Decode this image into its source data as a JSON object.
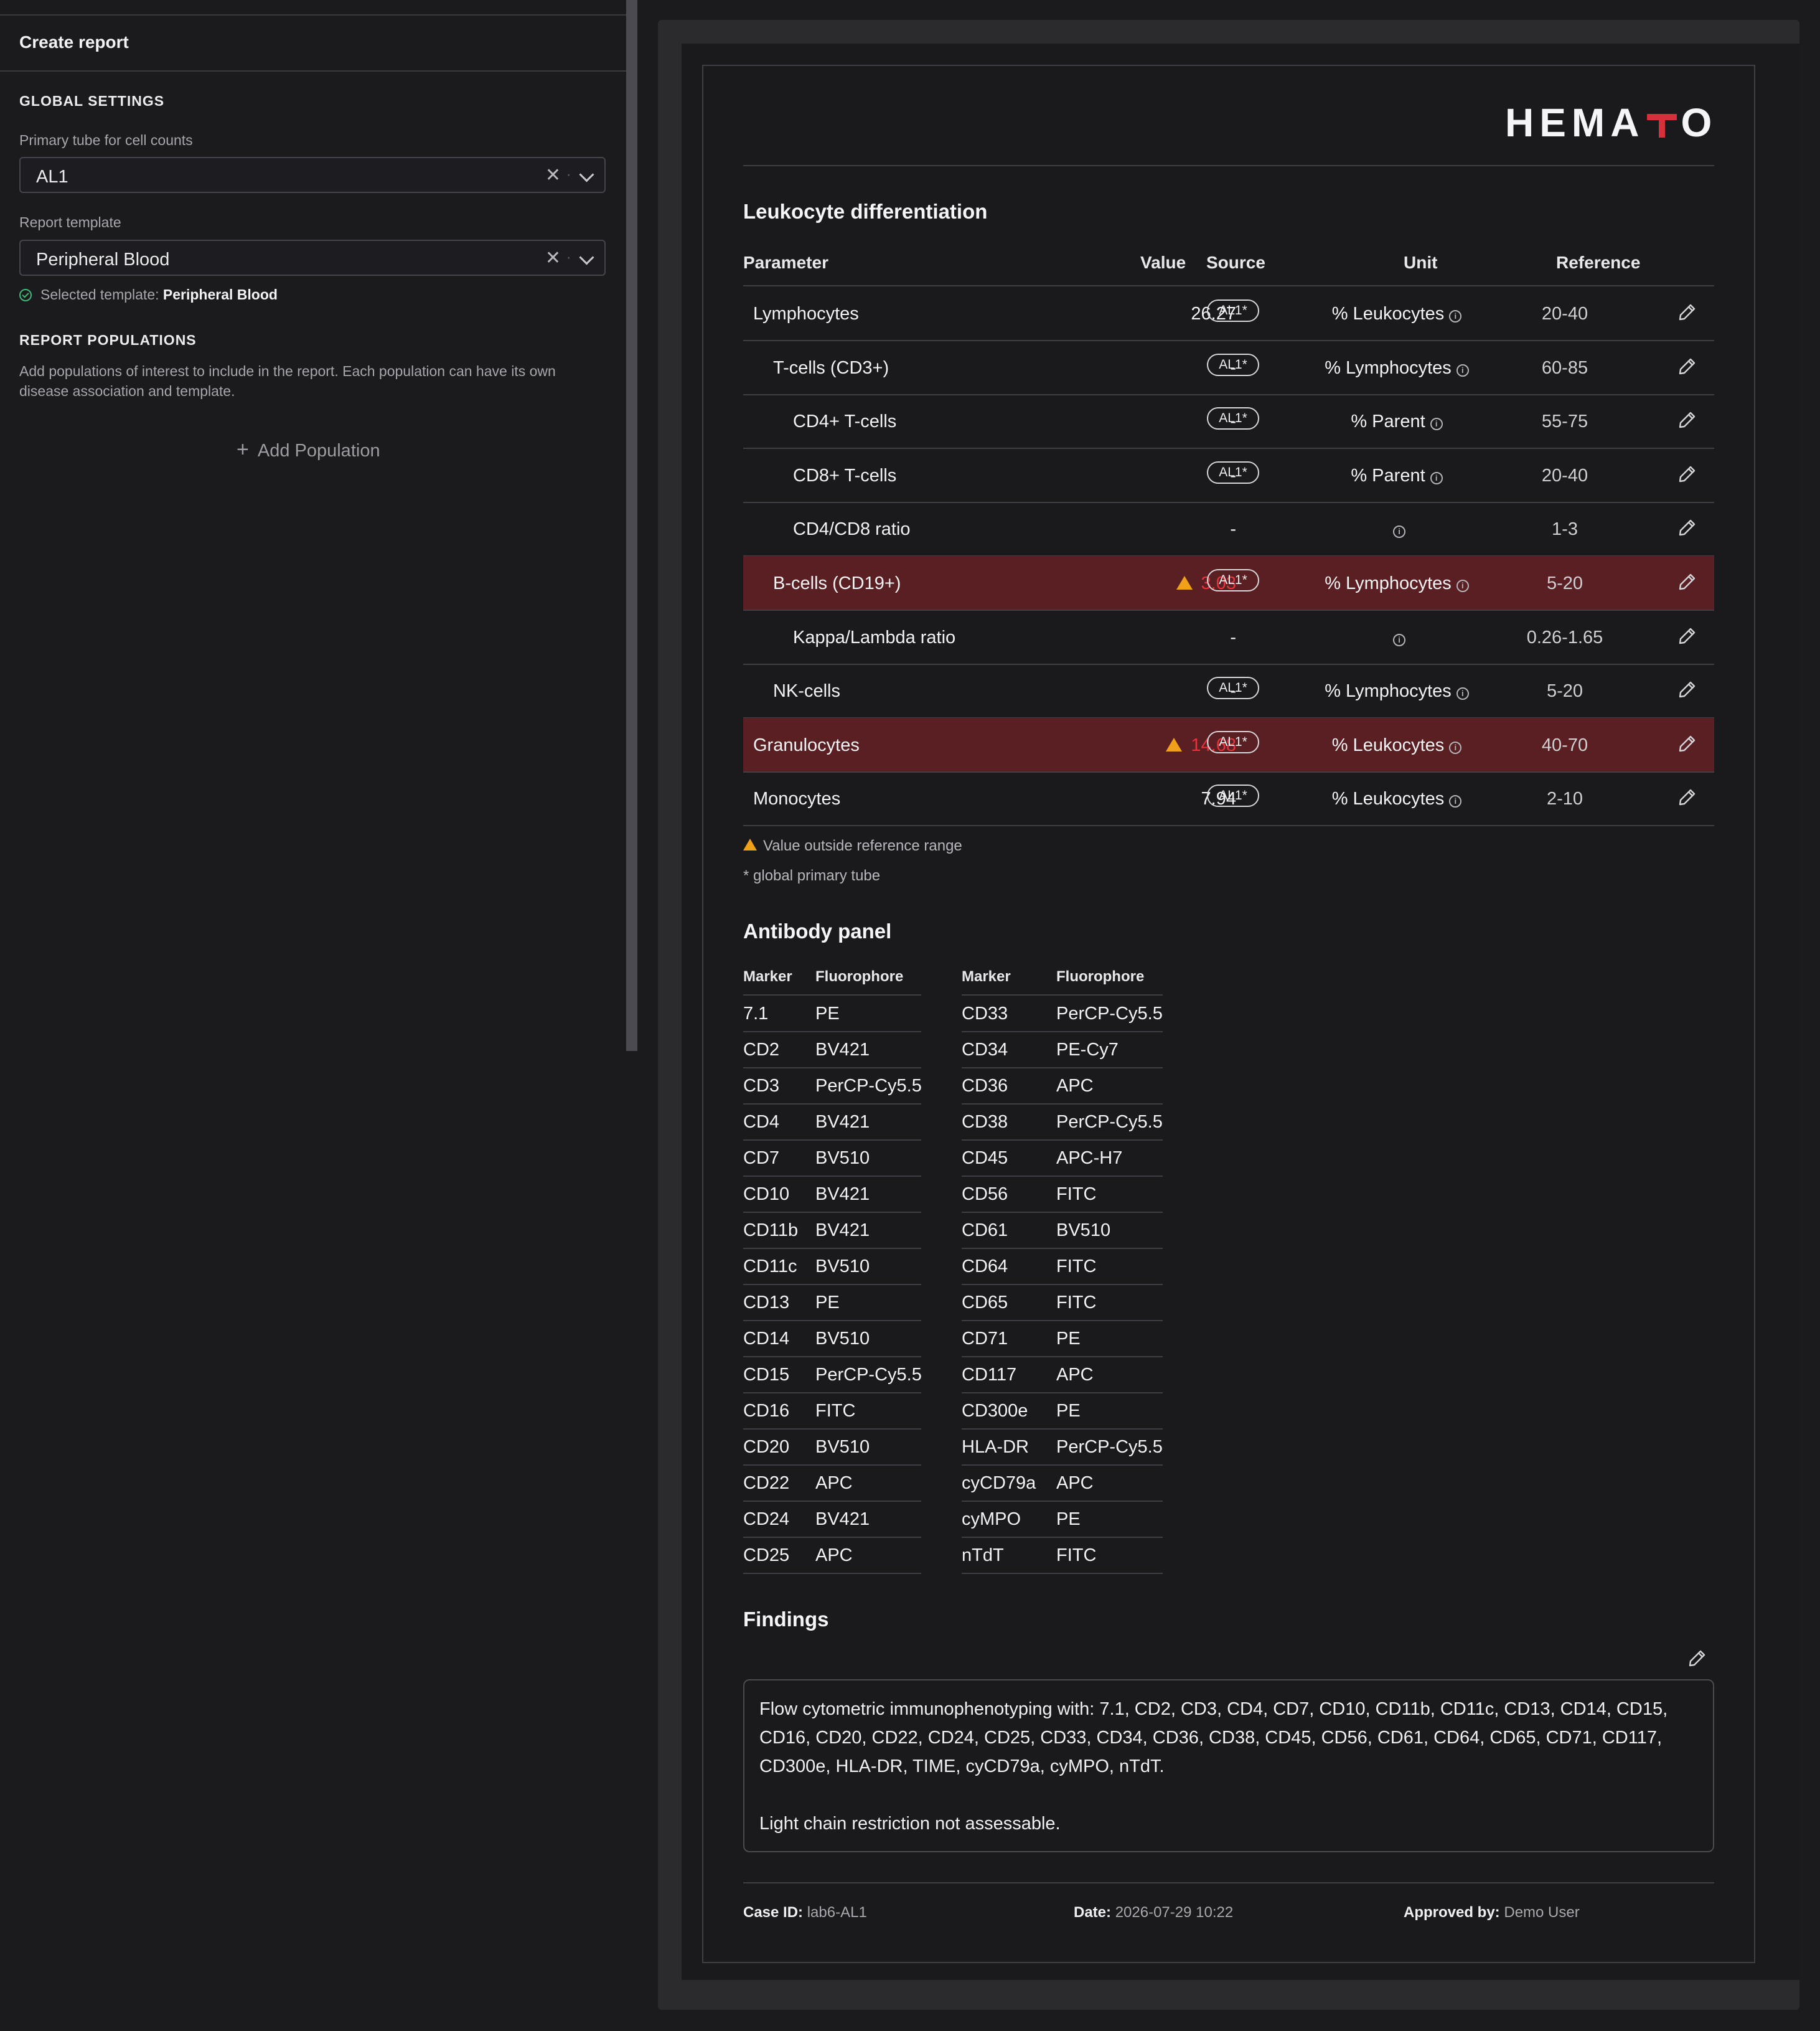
{
  "sidebar": {
    "title": "Create report",
    "global_settings_heading": "GLOBAL SETTINGS",
    "primary_tube_label": "Primary tube for cell counts",
    "primary_tube_value": "AL1",
    "template_label": "Report template",
    "template_value": "Peripheral Blood",
    "selected_template_prefix": "Selected template:",
    "selected_template_name": "Peripheral Blood",
    "populations_heading": "REPORT POPULATIONS",
    "populations_desc": "Add populations of interest to include in the report. Each population can have its own disease association and template.",
    "add_population_label": "Add Population"
  },
  "report": {
    "logo_left": "HEMA",
    "logo_right": "O",
    "leukocyte_heading": "Leukocyte differentiation",
    "columns": {
      "parameter": "Parameter",
      "value": "Value",
      "source": "Source",
      "unit": "Unit",
      "reference": "Reference"
    },
    "rows": [
      {
        "parameter": "Lymphocytes",
        "level": 0,
        "value": "26.27",
        "source": "AL1*",
        "unit": "% Leukocytes",
        "reference": "20-40",
        "flag": false
      },
      {
        "parameter": "T-cells (CD3+)",
        "level": 1,
        "value": "-",
        "source": "AL1*",
        "unit": "% Lymphocytes",
        "reference": "60-85",
        "flag": false
      },
      {
        "parameter": "CD4+ T-cells",
        "level": 2,
        "value": "-",
        "source": "AL1*",
        "unit": "% Parent",
        "reference": "55-75",
        "flag": false
      },
      {
        "parameter": "CD8+ T-cells",
        "level": 2,
        "value": "-",
        "source": "AL1*",
        "unit": "% Parent",
        "reference": "20-40",
        "flag": false
      },
      {
        "parameter": "CD4/CD8 ratio",
        "level": 2,
        "value": "-",
        "source": "",
        "unit": "",
        "reference": "1-3",
        "flag": false
      },
      {
        "parameter": "B-cells (CD19+)",
        "level": 1,
        "value": "3.03",
        "source": "AL1*",
        "unit": "% Lymphocytes",
        "reference": "5-20",
        "flag": true
      },
      {
        "parameter": "Kappa/Lambda ratio",
        "level": 2,
        "value": "-",
        "source": "",
        "unit": "",
        "reference": "0.26-1.65",
        "flag": false
      },
      {
        "parameter": "NK-cells",
        "level": 1,
        "value": "-",
        "source": "AL1*",
        "unit": "% Lymphocytes",
        "reference": "5-20",
        "flag": false
      },
      {
        "parameter": "Granulocytes",
        "level": 0,
        "value": "14.68",
        "source": "AL1*",
        "unit": "% Leukocytes",
        "reference": "40-70",
        "flag": true
      },
      {
        "parameter": "Monocytes",
        "level": 0,
        "value": "7.94",
        "source": "AL1*",
        "unit": "% Leukocytes",
        "reference": "2-10",
        "flag": false
      }
    ],
    "note_out_of_range": "Value outside reference range",
    "note_primary_tube": "* global primary tube",
    "antibody_heading": "Antibody panel",
    "antibody_columns": {
      "marker": "Marker",
      "fluorophore": "Fluorophore"
    },
    "antibody_left": [
      [
        "7.1",
        "PE"
      ],
      [
        "CD2",
        "BV421"
      ],
      [
        "CD3",
        "PerCP-Cy5.5"
      ],
      [
        "CD4",
        "BV421"
      ],
      [
        "CD7",
        "BV510"
      ],
      [
        "CD10",
        "BV421"
      ],
      [
        "CD11b",
        "BV421"
      ],
      [
        "CD11c",
        "BV510"
      ],
      [
        "CD13",
        "PE"
      ],
      [
        "CD14",
        "BV510"
      ],
      [
        "CD15",
        "PerCP-Cy5.5"
      ],
      [
        "CD16",
        "FITC"
      ],
      [
        "CD20",
        "BV510"
      ],
      [
        "CD22",
        "APC"
      ],
      [
        "CD24",
        "BV421"
      ],
      [
        "CD25",
        "APC"
      ]
    ],
    "antibody_right": [
      [
        "CD33",
        "PerCP-Cy5.5"
      ],
      [
        "CD34",
        "PE-Cy7"
      ],
      [
        "CD36",
        "APC"
      ],
      [
        "CD38",
        "PerCP-Cy5.5"
      ],
      [
        "CD45",
        "APC-H7"
      ],
      [
        "CD56",
        "FITC"
      ],
      [
        "CD61",
        "BV510"
      ],
      [
        "CD64",
        "FITC"
      ],
      [
        "CD65",
        "FITC"
      ],
      [
        "CD71",
        "PE"
      ],
      [
        "CD117",
        "APC"
      ],
      [
        "CD300e",
        "PE"
      ],
      [
        "HLA-DR",
        "PerCP-Cy5.5"
      ],
      [
        "cyCD79a",
        "APC"
      ],
      [
        "cyMPO",
        "PE"
      ],
      [
        "nTdT",
        "FITC"
      ]
    ],
    "findings_heading": "Findings",
    "findings_text_1": "Flow cytometric immunophenotyping with: 7.1, CD2, CD3, CD4, CD7, CD10, CD11b, CD11c, CD13, CD14, CD15, CD16, CD20, CD22, CD24, CD25, CD33, CD34, CD36, CD38, CD45, CD56, CD61, CD64, CD65, CD71, CD117, CD300e, HLA-DR, TIME, cyCD79a, cyMPO, nTdT.",
    "findings_text_2": "Light chain restriction not assessable.",
    "footer": {
      "case_label": "Case ID:",
      "case_value": "lab6-AL1",
      "date_label": "Date:",
      "date_value": "2026-07-29 10:22",
      "approved_label": "Approved by:",
      "approved_value": "Demo User"
    }
  },
  "colors": {
    "background": "#1b1b1e",
    "flag_row": "#5a1f22",
    "flag_value": "#e8333d",
    "warning_triangle": "#f0a019",
    "logo_accent": "#d6303a",
    "success_check": "#3fb87a"
  },
  "icons": [
    "close-icon",
    "chevron-down-icon",
    "check-circle-icon",
    "plus-icon",
    "info-icon",
    "pencil-icon",
    "warning-triangle-icon"
  ]
}
